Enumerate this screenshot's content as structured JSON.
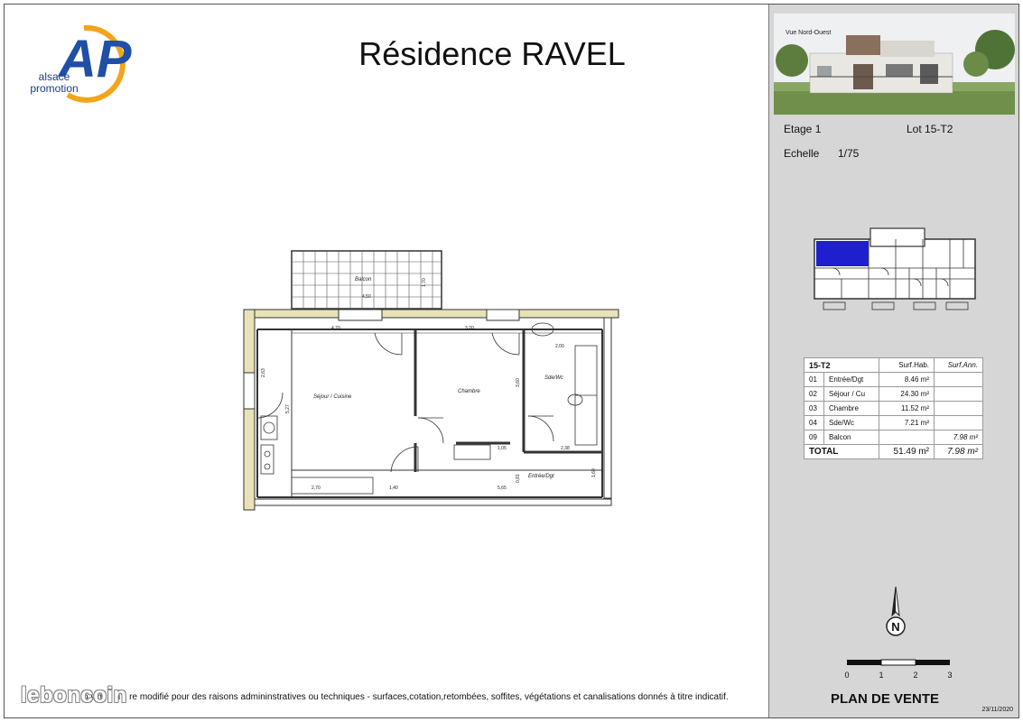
{
  "header": {
    "title": "Résidence RAVEL",
    "logo_text_line1": "alsace",
    "logo_text_line2": "promotion",
    "logo_letters": "AP"
  },
  "plan": {
    "rooms": {
      "balcon": "Balcon",
      "sejour": "Séjour / Cuisine",
      "chambre": "Chambre",
      "sdewc": "Sde/Wc",
      "entree": "Entrée/Dgt"
    },
    "dimensions": {
      "balcon_width": "4,50",
      "balcon_depth": "1,70",
      "sejour_width": "4,70",
      "chambre_width": "3,20",
      "sdewc_width": "2,00",
      "sejour_left_a": "2,63",
      "sejour_left_b": "5,27",
      "chambre_height": "3,60",
      "sdewc_right": "2,38",
      "closet": "1,05",
      "kitchen": "2,70",
      "hall_a": "1,40",
      "overall": "5,65",
      "hall_b": "0,81",
      "entree_height": "1,60"
    }
  },
  "side": {
    "photo_caption": "Vue Nord-Ouest",
    "etage_label": "Etage 1",
    "lot_label": "Lot 15-T2",
    "echelle_label": "Echelle",
    "echelle_value": "1/75",
    "table": {
      "headers": [
        "15-T2",
        "Surf.Hab.",
        "Surf.Ann."
      ],
      "rows": [
        {
          "code": "01",
          "label": "Entrée/Dgt",
          "hab": "8.46 m²",
          "ann": ""
        },
        {
          "code": "02",
          "label": "Séjour / Cu",
          "hab": "24.30 m²",
          "ann": ""
        },
        {
          "code": "03",
          "label": "Chambre",
          "hab": "11.52 m²",
          "ann": ""
        },
        {
          "code": "04",
          "label": "Sde/Wc",
          "hab": "7.21 m²",
          "ann": ""
        },
        {
          "code": "09",
          "label": "Balcon",
          "hab": "",
          "ann": "7.98 m²"
        }
      ],
      "total": {
        "label": "TOTAL",
        "hab": "51.49 m²",
        "ann": "7.98 m²"
      }
    },
    "north_letter": "N",
    "scale_labels": [
      "0",
      "1",
      "2",
      "3"
    ],
    "plan_de_vente": "PLAN DE VENTE",
    "date": "23/11/2020"
  },
  "footer": {
    "note_visible": "ι o  ε  m  ε  ι ι  ε re modifié pour des raisons admininstratives ou techniques - surfaces,cotation,retombées, soffites, végétations et canalisations donnés à titre indicatif.",
    "watermark": "leboncoin"
  },
  "colors": {
    "logo_blue": "#1f4fa6",
    "logo_orange": "#f2a51a",
    "wall_fill": "#e8e2b6",
    "highlight_blue": "#1f1fd0",
    "side_bg": "#d6d6d6"
  }
}
